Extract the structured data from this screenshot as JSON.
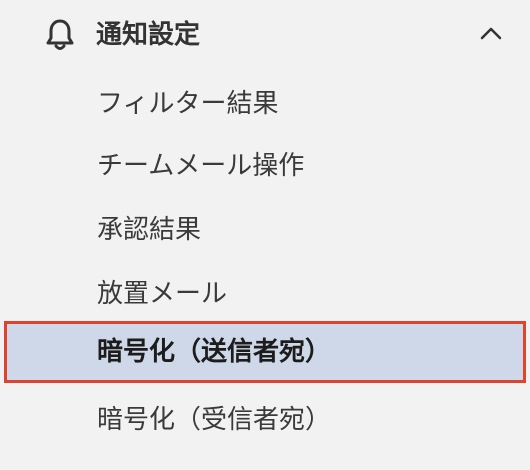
{
  "section": {
    "icon": "bell-icon",
    "title": "通知設定",
    "toggle_icon": "chevron-up-icon"
  },
  "items": [
    {
      "label": "フィルター結果",
      "selected": false
    },
    {
      "label": "チームメール操作",
      "selected": false
    },
    {
      "label": "承認結果",
      "selected": false
    },
    {
      "label": "放置メール",
      "selected": false
    },
    {
      "label": "暗号化（送信者宛）",
      "selected": true
    },
    {
      "label": "暗号化（受信者宛）",
      "selected": false
    }
  ],
  "colors": {
    "background": "#f2f2f2",
    "selected_background": "#cfd8e8",
    "highlight_border": "#e0432d",
    "text": "#333333"
  }
}
